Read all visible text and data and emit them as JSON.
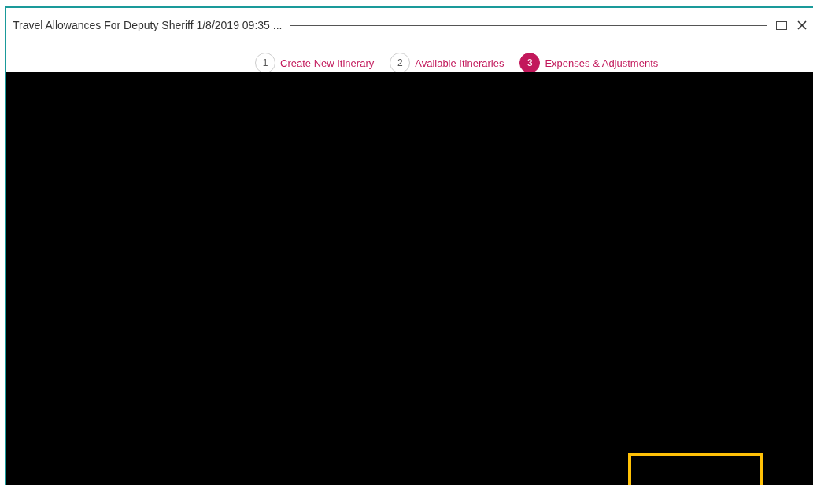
{
  "window": {
    "title": "Travel Allowances For Deputy Sheriff 1/8/2019 09:35 ..."
  },
  "steps": [
    {
      "number": "1",
      "label": "Create New Itinerary",
      "selected": false
    },
    {
      "number": "2",
      "label": "Available Itineraries",
      "selected": false
    },
    {
      "number": "3",
      "label": "Expenses & Adjustments",
      "selected": true
    }
  ]
}
